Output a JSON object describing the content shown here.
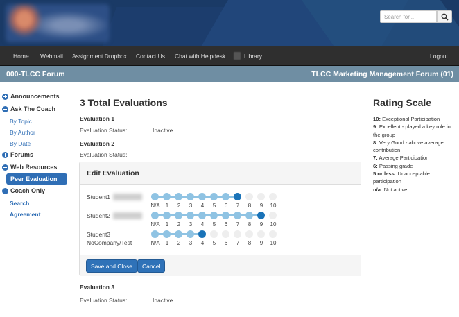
{
  "header": {
    "search_placeholder": "Search for...",
    "search_icon": "magnifier-icon"
  },
  "nav": {
    "items": [
      "Home",
      "Webmail",
      "Assignment Dropbox",
      "Contact Us",
      "Chat with Helpdesk",
      "Library"
    ],
    "logout": "Logout"
  },
  "forum": {
    "left_title": "000-TLCC Forum",
    "right_title": "TLCC Marketing Management Forum (01)"
  },
  "sidebar": {
    "announcements": "Announcements",
    "ask_coach": "Ask The Coach",
    "by_topic": "By Topic",
    "by_author": "By Author",
    "by_date": "By Date",
    "forums": "Forums",
    "web_resources": "Web Resources",
    "peer_evaluation": "Peer Evaluation",
    "coach_only": "Coach Only",
    "search": "Search",
    "agreement": "Agreement"
  },
  "main": {
    "title": "3 Total Evaluations",
    "evaluations": [
      {
        "heading": "Evaluation 1",
        "status_label": "Evaluation Status:",
        "status_value": "Inactive"
      },
      {
        "heading": "Evaluation 2",
        "status_label": "Evaluation Status:",
        "status_value": ""
      },
      {
        "heading": "Evaluation 3",
        "status_label": "Evaluation Status:",
        "status_value": "Inactive"
      }
    ],
    "edit_panel": {
      "title": "Edit Evaluation",
      "scale_labels": [
        "N/A",
        "1",
        "2",
        "3",
        "4",
        "5",
        "6",
        "7",
        "8",
        "9",
        "10"
      ],
      "students": [
        {
          "name": "Student1",
          "name_line2": "",
          "rating": "7"
        },
        {
          "name": "Student2",
          "name_line2": "",
          "rating": "9"
        },
        {
          "name": "Student3",
          "name_line2": "NoCompany/Test",
          "rating": "4"
        }
      ],
      "save_button": "Save and Close",
      "cancel_button": "Cancel"
    }
  },
  "rating_scale": {
    "title": "Rating Scale",
    "entries": [
      {
        "key": "10:",
        "text": " Exceptional Participation"
      },
      {
        "key": "9:",
        "text": " Excellent - played a key role in the group"
      },
      {
        "key": "8:",
        "text": " Very Good - above average contribution"
      },
      {
        "key": "7:",
        "text": " Average Participation"
      },
      {
        "key": "6:",
        "text": " Passing grade"
      },
      {
        "key": "5 or less:",
        "text": " Unacceptable participation"
      },
      {
        "key": "n/a:",
        "text": " Not active"
      }
    ]
  },
  "colors": {
    "accent": "#2f6eb5",
    "selected_dot": "#1a73b8",
    "filled_dot": "#8fc3e3",
    "forum_bar": "#6f8ea3",
    "nav_bar": "#2f2f2f"
  }
}
